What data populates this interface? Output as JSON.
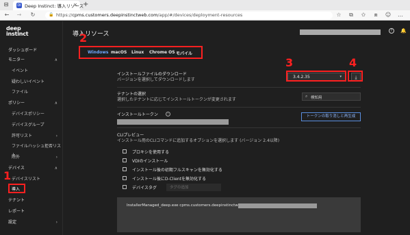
{
  "browser": {
    "tab_title": "Deep Instinct: 導入リソース",
    "tab_favicon": "DI",
    "url_prefix": "https://",
    "url_host": "cpms.customers.deepinstinctweb.com",
    "url_path": "/app/#/devices/deployment-resources",
    "win_menu_icon": "⊟",
    "win_back_icon": "⎘",
    "new_tab_icon": "+",
    "back_icon": "←",
    "forward_icon": "→",
    "reload_icon": "↻",
    "lock_icon": "🔒",
    "star_icon": "☆",
    "collections_icon": "⧉",
    "favorites_icon": "✩",
    "share_icon": "⧈",
    "profile_icon": "☺",
    "more_icon": "…",
    "close_tab_icon": "×"
  },
  "sidebar": {
    "logo_line1": "deep",
    "logo_line2": "instinct",
    "items": [
      {
        "label": "ダッシュボード"
      },
      {
        "label": "モニター",
        "chevron": "∧"
      },
      {
        "label": "イベント"
      },
      {
        "label": "疑わしいイベント"
      },
      {
        "label": "ファイル"
      },
      {
        "label": "ポリシー",
        "chevron": "∧"
      },
      {
        "label": "デバイスポリシー"
      },
      {
        "label": "デバイスグループ"
      },
      {
        "label": "許可リスト",
        "chevron": "›"
      },
      {
        "label": "ファイルハッシュ拒否リスト"
      },
      {
        "label": "除外",
        "chevron": "›"
      },
      {
        "label": "デバイス",
        "chevron": "∧"
      },
      {
        "label": "デバイスリスト"
      },
      {
        "label": "導入"
      },
      {
        "label": "テナント"
      },
      {
        "label": "レポート"
      },
      {
        "label": "設定",
        "chevron": "›"
      }
    ]
  },
  "main": {
    "page_title": "導入リソース",
    "help_icon": "?",
    "bell_icon": "🔔",
    "os_tabs": [
      "Windows",
      "macOS",
      "Linux",
      "Chrome OS",
      "モバイル"
    ],
    "download": {
      "label": "インストールファイルのダウンロード",
      "desc": "バージョンを選択してダウンロードします",
      "version": "3.4.2.35",
      "arrow": "▾",
      "download_icon": "⤓"
    },
    "tenant": {
      "label": "テナントの選択",
      "desc": "選択したテナントに応じてインストールトークンが変更されます",
      "icon": "⌕",
      "value": "検知用"
    },
    "token": {
      "label": "インストールトークン",
      "info_icon": "i",
      "regen_label": "トークンの取り消しと再生成"
    },
    "cli": {
      "label": "CLIプレビュー",
      "desc": "インストール用のCLIコマンドに追加するオプションを選択します (バージョン 2.4以降)",
      "options": [
        "プロキシを使用する",
        "VDIのインストール",
        "インストール後の初期フルスキャンを無効化する",
        "インストール後にD-Clientを無効化する",
        "デバイスタグ"
      ],
      "tag_placeholder": "タグの追加",
      "command": "InstallerManaged_deep.exe cpms.customers.deepinstinctweb.com"
    }
  },
  "annotations": {
    "n1": "1",
    "n2": "2",
    "n3": "3",
    "n4": "4",
    "color": "#ff2020"
  }
}
